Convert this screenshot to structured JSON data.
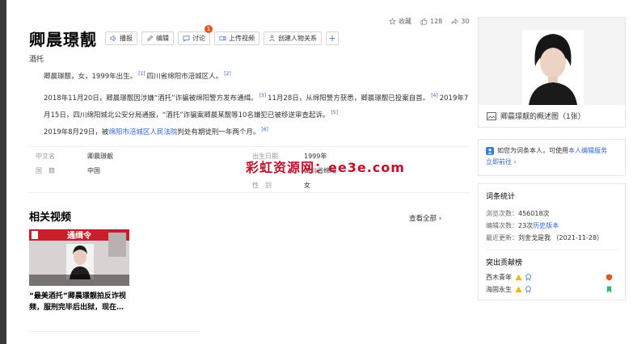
{
  "title": "卿晨璟靓",
  "subtitle": "酒托",
  "toolbar": {
    "play": "播报",
    "edit": "编辑",
    "discuss": "讨论",
    "discuss_badge": "1",
    "upload": "上传视频",
    "relation": "创建人物关系",
    "plus": "+"
  },
  "stats": {
    "collect": "收藏",
    "likes": "128",
    "shares": "30"
  },
  "paragraphs": {
    "p1a": "卿晨璟靓，女，1999年出生。",
    "p1s1": "[1]",
    "p1b": "四川省绵阳市涪城区人。",
    "p1s2": "[2]",
    "p2a": "2018年11月20日，卿晨璟靓因涉嫌“酒托”诈骗被绵阳警方发布通缉。",
    "p2s1": "[3]",
    "p2b": "11月28日，从绵阳警方获悉，卿晨璟靓已投案自首。",
    "p2s2": "[4]",
    "p2c": "2019年7月15日，四川绵阳城北公安分局通报，“酒托”诈骗案卿晨某靓等10名嫌犯已被移送审查起诉。",
    "p2s3": "[5]",
    "p3a": "2019年8月29日，被",
    "p3link": "绵阳市涪城区人民法院",
    "p3b": "判处有期徒刑一年两个月。",
    "p3s1": "[6]"
  },
  "basic_info": {
    "name_key": "中文名",
    "name_val": "卿晨璟靓",
    "nation_key": "国　籍",
    "nation_val": "中国",
    "birth_key": "出生日期",
    "birth_val": "1999年",
    "place_val": "四川省绵阳",
    "gender_key": "性　别",
    "gender_val": "女"
  },
  "watermark": "彩虹资源网：ee3e.com",
  "videos": {
    "section_title": "相关视频",
    "view_all": "查看全部 ›",
    "thumb_text": "通缉令",
    "caption": "“最美酒托”卿晨璟靓拍反诈视频，服刑完毕后出狱，现在…"
  },
  "sidebar": {
    "photo_caption": "卿晨璟靓的概述图（1张）",
    "notice_a": "如您为词条本人，可使用",
    "notice_link": "本人编辑服务",
    "notice_b": "立即前往 ›",
    "stats_title": "词条统计",
    "views_key": "浏览次数：",
    "views_val": "456018次",
    "edits_key": "编辑次数：",
    "edits_val": "23次",
    "edits_link": "历史版本",
    "updated_key": "最近更新：",
    "updated_val": "刘金戈是我 （2021-11-28）",
    "contrib_title": "突出贡献榜",
    "contrib1": "西木青年",
    "contrib2": "海固永生"
  },
  "colors": {
    "link": "#3366cc",
    "badge": "#e8541e",
    "watermark": "#c0112b"
  }
}
